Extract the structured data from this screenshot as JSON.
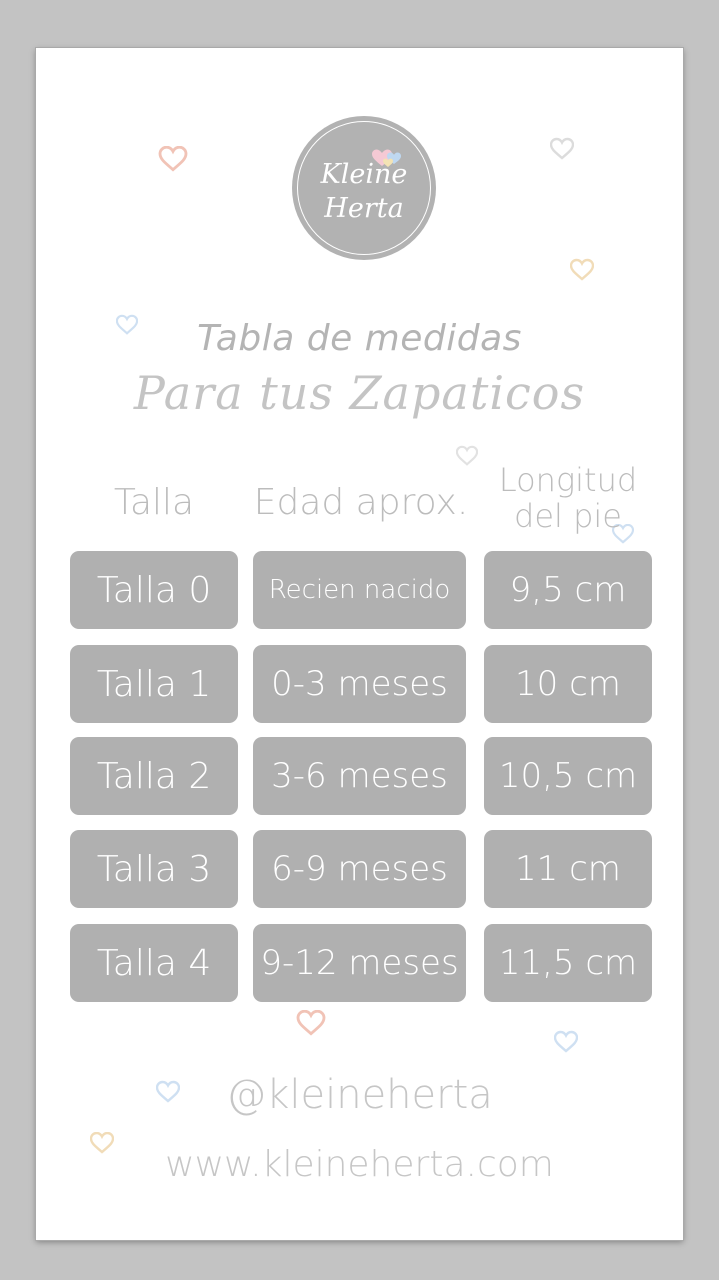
{
  "brand": {
    "line1": "Kleine",
    "line2": "Herta"
  },
  "title": "Tabla de medidas",
  "subtitle": "Para tus Zapaticos",
  "columns": {
    "size": "Talla",
    "age": "Edad aprox.",
    "length_line1": "Longitud",
    "length_line2": "del pie"
  },
  "rows": [
    {
      "size": "Talla 0",
      "age": "Recien nacido",
      "length": "9,5 cm"
    },
    {
      "size": "Talla 1",
      "age": "0-3 meses",
      "length": "10 cm"
    },
    {
      "size": "Talla 2",
      "age": "3-6 meses",
      "length": "10,5 cm"
    },
    {
      "size": "Talla 3",
      "age": "6-9 meses",
      "length": "11 cm"
    },
    {
      "size": "Talla 4",
      "age": "9-12 meses",
      "length": "11,5 cm"
    }
  ],
  "social": "@kleineherta",
  "website": "www.kleineherta.com",
  "colors": {
    "background": "#c3c3c3",
    "card": "#ffffff",
    "cell": "#b0b0b0",
    "text_light": "#bcbcbc",
    "heart_pink": "#f3c6bd",
    "heart_blue": "#cfe0f2",
    "heart_yellow": "#f3e2c4",
    "heart_gray": "#dedede"
  },
  "icons": {
    "decorations": "heart-icon",
    "logo": "kleine-herta-logo"
  }
}
